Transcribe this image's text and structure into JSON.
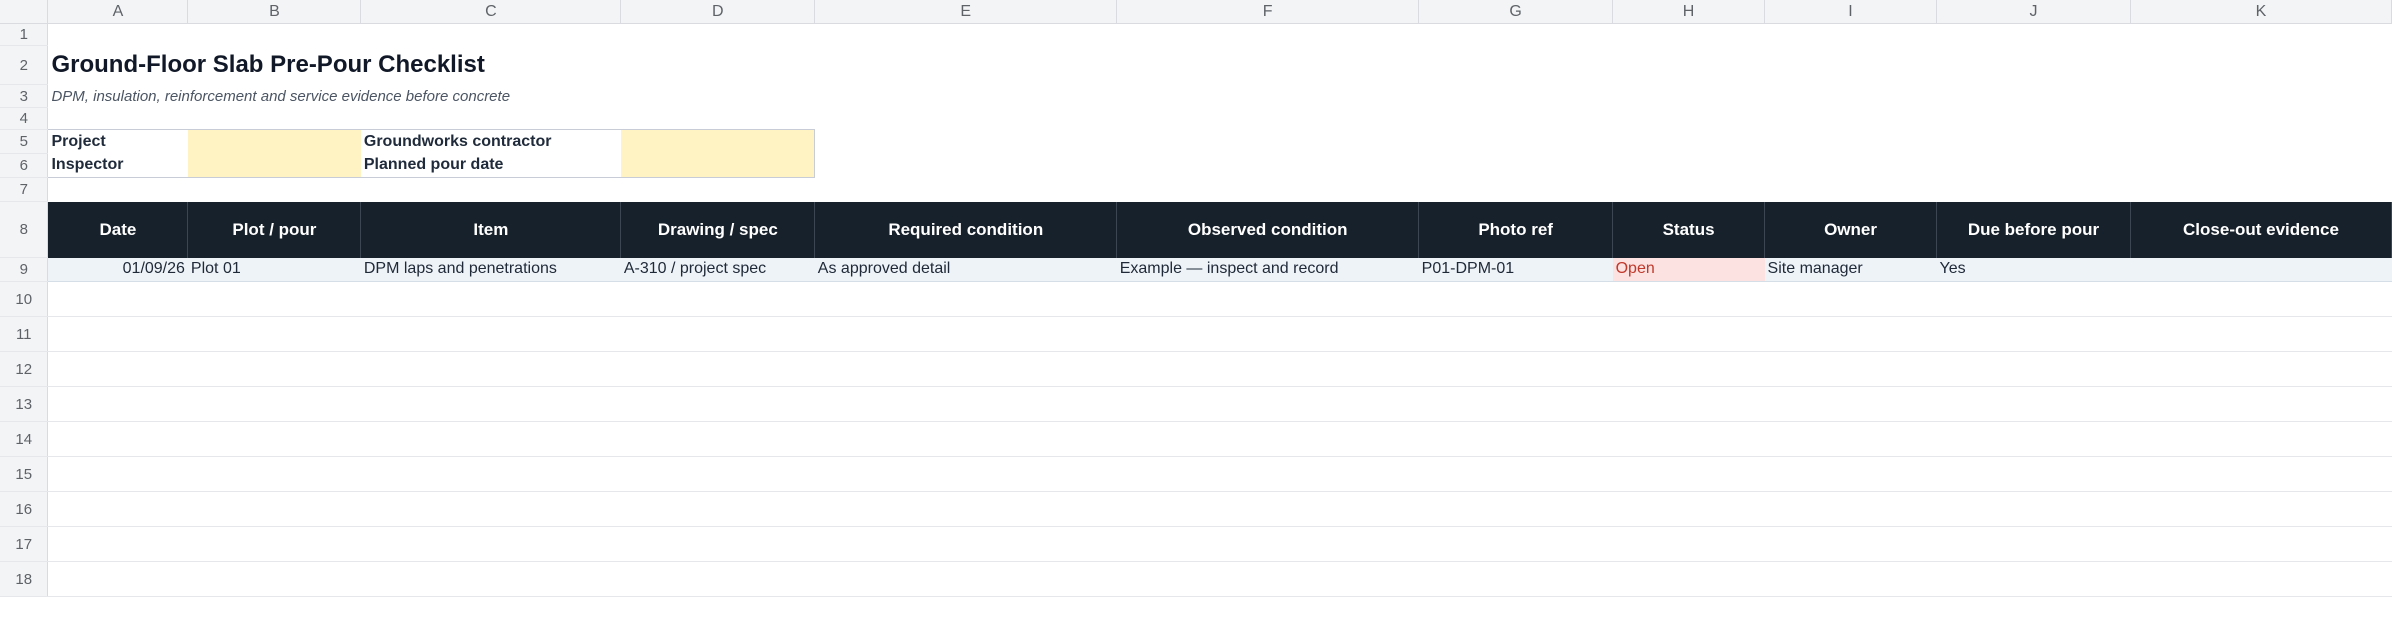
{
  "columns": [
    "A",
    "B",
    "C",
    "D",
    "E",
    "F",
    "G",
    "H",
    "I",
    "J",
    "K"
  ],
  "rows": [
    "1",
    "2",
    "3",
    "4",
    "5",
    "6",
    "7",
    "8",
    "9",
    "10",
    "11",
    "12",
    "13",
    "14",
    "15",
    "16",
    "17",
    "18"
  ],
  "title": "Ground-Floor Slab Pre-Pour Checklist",
  "subtitle": "DPM, insulation, reinforcement and service evidence before concrete",
  "meta": {
    "project_label": "Project",
    "project_value": "",
    "inspector_label": "Inspector",
    "inspector_value": "",
    "contractor_label": "Groundworks contractor",
    "contractor_value": "",
    "pour_date_label": "Planned pour date",
    "pour_date_value": ""
  },
  "table": {
    "headers": [
      "Date",
      "Plot / pour",
      "Item",
      "Drawing / spec",
      "Required condition",
      "Observed condition",
      "Photo ref",
      "Status",
      "Owner",
      "Due before pour",
      "Close-out evidence"
    ],
    "rows": [
      [
        "01/09/26",
        "Plot 01",
        "DPM laps and penetrations",
        "A-310 / project spec",
        "As approved detail",
        "Example — inspect and record",
        "P01-DPM-01",
        "Open",
        "Site manager",
        "Yes",
        ""
      ]
    ]
  },
  "colors": {
    "header_bg": "#17212b",
    "input_fill": "#fff3c4",
    "status_open_bg": "#fde2e2",
    "status_open_text": "#c0392b",
    "data_row_bg": "#eef3f8"
  }
}
